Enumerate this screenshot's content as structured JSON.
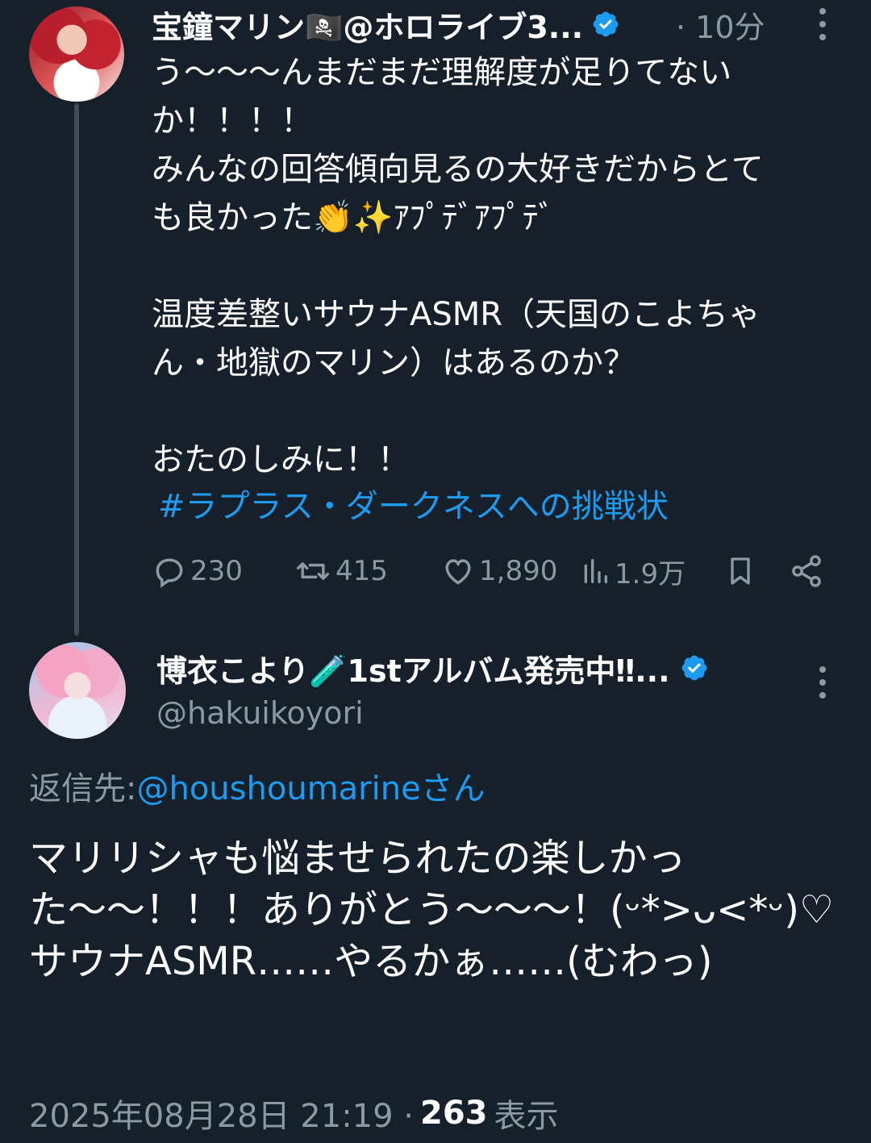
{
  "tweet1": {
    "display_name": "宝鐘マリン🏴‍☠️@ホロライブ3...",
    "time": "· 10分",
    "text": "う〜〜〜んまだまだ理解度が足りてない\nか！！！！\nみんなの回答傾向見るの大好きだからとて\nも良かった👏✨ｱﾌﾟﾃﾞｱﾌﾟﾃﾞ\n\n温度差整いサウナASMR（天国のこよちゃ\nん・地獄のマリン）はあるのか？\n\nおたのしみに！！",
    "hashtag": "#ラプラス・ダークネスへの挑戦状",
    "actions": {
      "replies": "230",
      "reposts": "415",
      "likes": "1,890",
      "views": "1.9万"
    }
  },
  "tweet2": {
    "display_name": "博衣こより🧪1stアルバム発売中‼...",
    "handle": "@hakuikoyori",
    "reply_to_label": "返信先: ",
    "reply_to_mention": "@houshoumarineさん",
    "text": "マリリシャも悩ませられたの楽しかっ\nた〜〜！！！ありがとう〜〜〜！(ᵕ*>ᴗ<*ᵕ)♡\nサウナASMR……やるかぁ……(むわっ)",
    "timestamp": "2025年08月28日 21:19 ·",
    "view_count": "263",
    "view_label": "表示"
  },
  "colors": {
    "background": "#15202b",
    "accent": "#1d9bf0",
    "muted": "#8b98a5"
  }
}
